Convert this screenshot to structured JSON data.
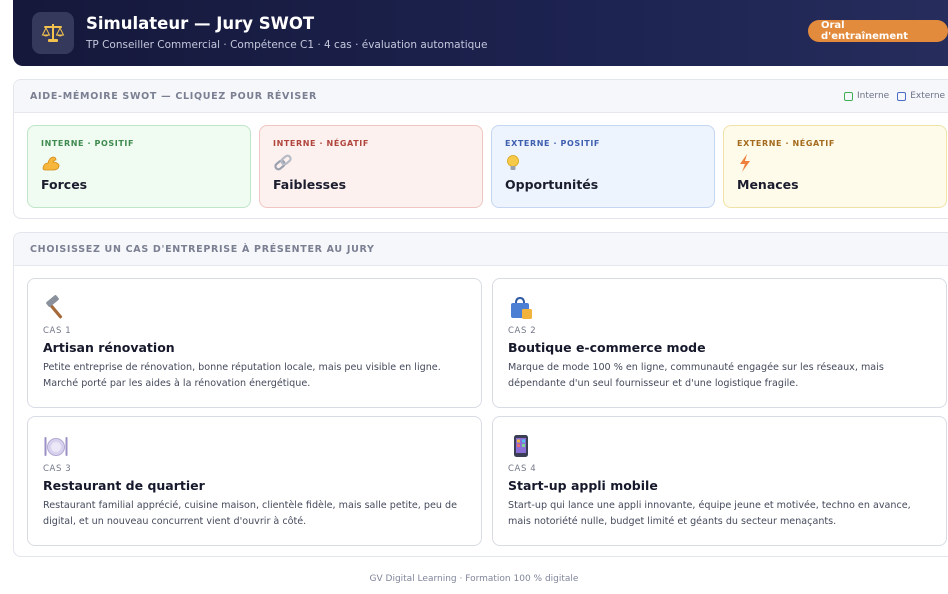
{
  "header": {
    "logo_icon": "scales-icon",
    "title": "Simulateur — Jury SWOT",
    "subtitle": "TP Conseiller Commercial · Compétence C1 · 4 cas · évaluation automatique",
    "badge": "Oral d'entraînement",
    "badge_color": "#e38b3c"
  },
  "memo": {
    "title": "AIDE-MÉMOIRE SWOT — CLIQUEZ POUR RÉVISER",
    "legend": [
      {
        "label": "Interne",
        "color": "#3fae5a"
      },
      {
        "label": "Externe",
        "color": "#4a6bc8"
      }
    ],
    "cards": [
      {
        "category": "INTERNE · POSITIF",
        "name": "Forces",
        "icon": "flexed-biceps-icon",
        "accent": "#3e8a4f",
        "bg": "#f0fbf2",
        "border": "#bfe6c8"
      },
      {
        "category": "INTERNE · NÉGATIF",
        "name": "Faiblesses",
        "icon": "chain-link-icon",
        "accent": "#b0453c",
        "bg": "#fcf1ef",
        "border": "#efc6c1"
      },
      {
        "category": "EXTERNE · POSITIF",
        "name": "Opportunités",
        "icon": "light-bulb-icon",
        "accent": "#3e5fb0",
        "bg": "#eef4fd",
        "border": "#c4d6f1"
      },
      {
        "category": "EXTERNE · NÉGATIF",
        "name": "Menaces",
        "icon": "lightning-icon",
        "accent": "#a46a1d",
        "bg": "#fefbea",
        "border": "#f0e2a6"
      }
    ]
  },
  "cases": {
    "title": "CHOISISSEZ UN CAS D'ENTREPRISE À PRÉSENTER AU JURY",
    "items": [
      {
        "number": "CAS 1",
        "title": "Artisan rénovation",
        "icon": "hammer-icon",
        "description": "Petite entreprise de rénovation, bonne réputation locale, mais peu visible en ligne. Marché porté par les aides à la rénovation énergétique."
      },
      {
        "number": "CAS 2",
        "title": "Boutique e-commerce mode",
        "icon": "shopping-bag-icon",
        "description": "Marque de mode 100 % en ligne, communauté engagée sur les réseaux, mais dépendante d'un seul fournisseur et d'une logistique fragile."
      },
      {
        "number": "CAS 3",
        "title": "Restaurant de quartier",
        "icon": "plate-cutlery-icon",
        "description": "Restaurant familial apprécié, cuisine maison, clientèle fidèle, mais salle petite, peu de digital, et un nouveau concurrent vient d'ouvrir à côté."
      },
      {
        "number": "CAS 4",
        "title": "Start-up appli mobile",
        "icon": "mobile-phone-icon",
        "description": "Start-up qui lance une appli innovante, équipe jeune et motivée, techno en avance, mais notoriété nulle, budget limité et géants du secteur menaçants."
      }
    ]
  },
  "footer": "GV Digital Learning · Formation 100 % digitale"
}
